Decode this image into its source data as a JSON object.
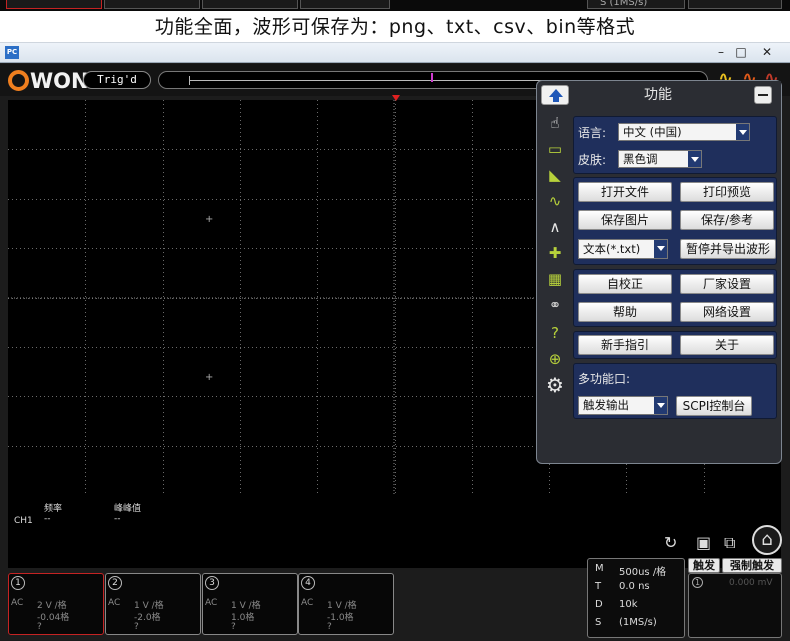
{
  "caption": "功能全面，波形可保存为：png、txt、csv、bin等格式",
  "top_strip": {
    "partial_text": "S    (1MS/s)"
  },
  "window": {
    "app_icon_label": "PC",
    "controls": {
      "minimize": "–",
      "maximize": "□",
      "close": "✕"
    }
  },
  "header": {
    "logo": "WON",
    "trigger_status": "Trig'd"
  },
  "panel": {
    "title": "功能",
    "language_label": "语言:",
    "language_value": "中文 (中国)",
    "skin_label": "皮肤:",
    "skin_value": "黑色调",
    "buttons": {
      "open_file": "打开文件",
      "print_preview": "打印预览",
      "save_image": "保存图片",
      "save_ref": "保存/参考",
      "file_type": "文本(*.txt)",
      "pause_export": "暂停并导出波形",
      "self_cal": "自校正",
      "factory": "厂家设置",
      "help": "帮助",
      "network": "网络设置",
      "guide": "新手指引",
      "about": "关于",
      "multi_port_label": "多功能口:",
      "trigger_out": "触发输出",
      "scpi": "SCPI控制台"
    }
  },
  "measure": {
    "channel": "CH1",
    "freq_label": "频率",
    "freq_value": "--",
    "ptp_label": "峰峰值",
    "ptp_value": "--"
  },
  "channels": [
    {
      "num": "1",
      "coupling": "AC",
      "scale": "2 V /格",
      "offset": "-0.04格",
      "extra": "?"
    },
    {
      "num": "2",
      "coupling": "AC",
      "scale": "1 V /格",
      "offset": "-2.0格",
      "extra": "?"
    },
    {
      "num": "3",
      "coupling": "AC",
      "scale": "1 V /格",
      "offset": "1.0格",
      "extra": "?"
    },
    {
      "num": "4",
      "coupling": "AC",
      "scale": "1 V /格",
      "offset": "-1.0格",
      "extra": "?"
    }
  ],
  "timebase": {
    "M_label": "M",
    "M_value": "500us /格",
    "T_label": "T",
    "T_value": "0.0 ns",
    "D_label": "D",
    "D_value": "10k",
    "S_label": "S",
    "S_value": "(1MS/s)"
  },
  "trigger": {
    "tab_trigger": "触发",
    "tab_force": "强制触发",
    "source": "1",
    "level": "0.000 mV"
  },
  "colors": {
    "accent_orange": "#f07f1f",
    "trigger_marker": "#e02020",
    "panel_group_bg": "#1f2f5c",
    "icon_green": "#b7d13b"
  }
}
